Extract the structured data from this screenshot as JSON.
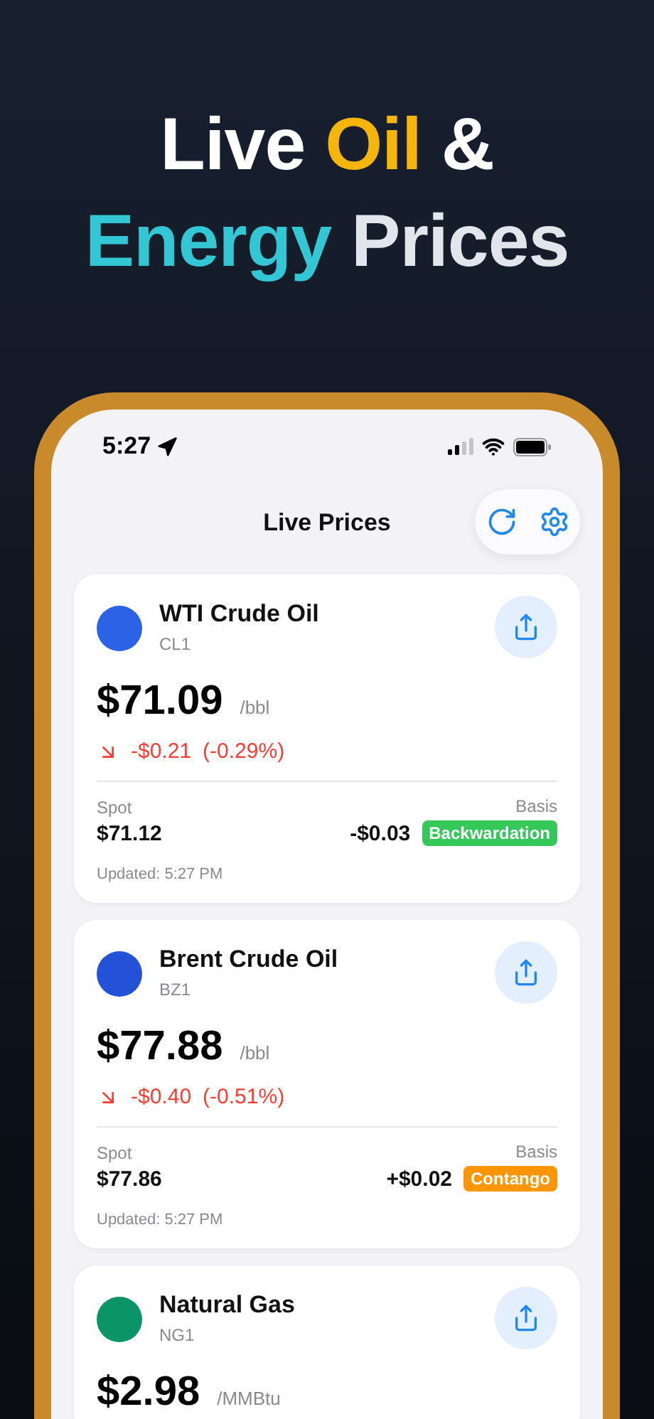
{
  "headline": [
    {
      "segments": [
        {
          "text": "Live ",
          "color": "#ffffff"
        },
        {
          "text": "Oil",
          "color": "#f5b50a"
        },
        {
          "text": " &",
          "color": "#ffffff"
        }
      ]
    },
    {
      "segments": [
        {
          "text": "Energy",
          "color": "#33c6d4"
        },
        {
          "text": " Prices",
          "color": "#e3e5ec"
        }
      ]
    }
  ],
  "status_bar": {
    "time": "5:27"
  },
  "nav": {
    "title": "Live Prices"
  },
  "cards": [
    {
      "name": "WTI Crude Oil",
      "symbol": "CL1",
      "color": "#2c63e6",
      "price": "$71.09",
      "unit": "/bbl",
      "change": {
        "falling": true,
        "amount": "-$0.21",
        "percent": "(-0.29%)"
      },
      "spot_label": "Spot",
      "spot": "$71.12",
      "basis_label": "Basis",
      "basis": "-$0.03",
      "structure": {
        "label": "Backwardation",
        "kind": "backwardation"
      },
      "updated": "Updated: 5:27 PM"
    },
    {
      "name": "Brent Crude Oil",
      "symbol": "BZ1",
      "color": "#2352d8",
      "price": "$77.88",
      "unit": "/bbl",
      "change": {
        "falling": true,
        "amount": "-$0.40",
        "percent": "(-0.51%)"
      },
      "spot_label": "Spot",
      "spot": "$77.86",
      "basis_label": "Basis",
      "basis": "+$0.02",
      "structure": {
        "label": "Contango",
        "kind": "contango"
      },
      "updated": "Updated: 5:27 PM"
    },
    {
      "name": "Natural Gas",
      "symbol": "NG1",
      "color": "#0b9566",
      "price": "$2.98",
      "unit": "/MMBtu"
    }
  ]
}
